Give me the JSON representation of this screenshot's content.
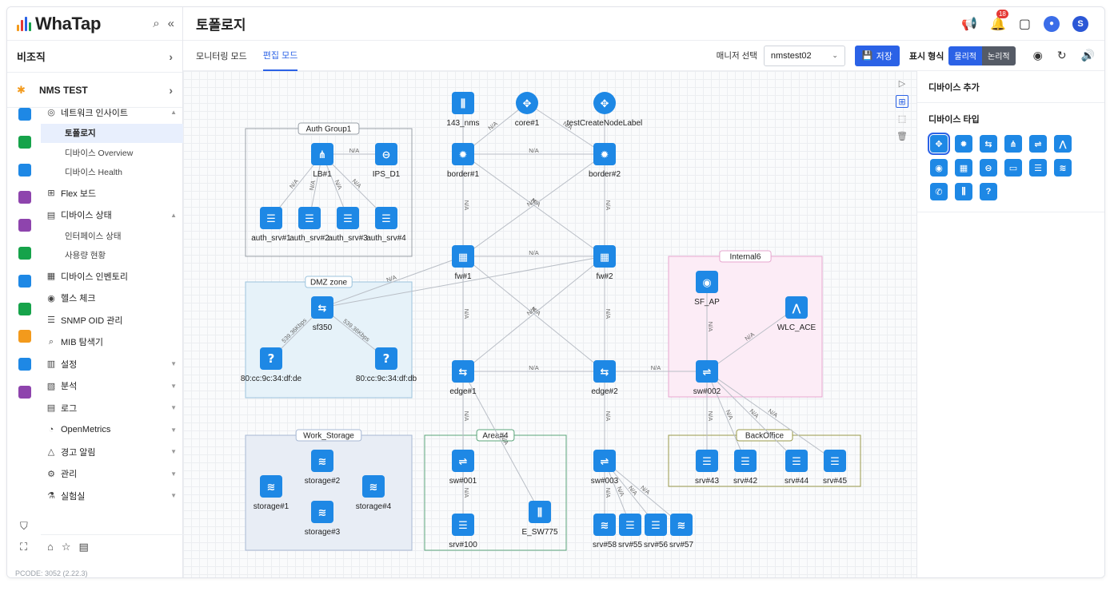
{
  "brand": {
    "name": "WhaTap",
    "bar_colors": [
      "#f39a1c",
      "#e53935",
      "#2b62e6",
      "#16a34a"
    ]
  },
  "sidebar": {
    "org_label": "비조직",
    "project_label": "NMS TEST",
    "rail_colors": [
      "#1e88e5",
      "#16a34a",
      "#1e88e5",
      "#8e44ad",
      "#8e44ad",
      "#16a34a",
      "#1e88e5",
      "#16a34a",
      "#f39a1c",
      "#1e88e5",
      "#8e44ad"
    ],
    "menu": [
      {
        "icon": "globe-icon",
        "glyph": "◎",
        "label": "네트워크 인사이트",
        "caret": "▲",
        "subs": [
          "토폴로지",
          "디바이스 Overview",
          "디바이스 Health"
        ]
      },
      {
        "icon": "board-icon",
        "glyph": "⊞",
        "label": "Flex 보드"
      },
      {
        "icon": "device-status-icon",
        "glyph": "▤",
        "label": "디바이스 상태",
        "caret": "▲",
        "subs": [
          "인터페이스 상태",
          "사용량 현황"
        ]
      },
      {
        "icon": "inventory-icon",
        "glyph": "▦",
        "label": "디바이스 인벤토리"
      },
      {
        "icon": "eye-icon",
        "glyph": "◉",
        "label": "헬스 체크"
      },
      {
        "icon": "list-icon",
        "glyph": "☰",
        "label": "SNMP OID 관리"
      },
      {
        "icon": "search-doc-icon",
        "glyph": "⌕",
        "label": "MIB 탐색기"
      },
      {
        "icon": "chart-icon",
        "glyph": "▥",
        "label": "설정",
        "caret": "▼"
      },
      {
        "icon": "analysis-icon",
        "glyph": "▧",
        "label": "분석",
        "caret": "▼"
      },
      {
        "icon": "log-icon",
        "glyph": "▤",
        "label": "로그",
        "caret": "▼"
      },
      {
        "icon": "gauge-icon",
        "glyph": "◔",
        "label": "OpenMetrics",
        "caret": "▼"
      },
      {
        "icon": "bell-icon",
        "glyph": "△",
        "label": "경고 알림",
        "caret": "▼"
      },
      {
        "icon": "gear-icon",
        "glyph": "⚙",
        "label": "관리",
        "caret": "▼"
      },
      {
        "icon": "flask-icon",
        "glyph": "⚗",
        "label": "실험실",
        "caret": "▼"
      }
    ],
    "pcode": "PCODE: 3052 (2.22.3)"
  },
  "header": {
    "title": "토폴로지",
    "notification_count": "18",
    "avatar_letter": "S"
  },
  "toolbar": {
    "tabs": [
      "모니터링 모드",
      "편집 모드"
    ],
    "manager_label": "매니저 선택",
    "manager_value": "nmstest02",
    "save_label": "저장",
    "display_label": "표시 형식",
    "display_options": [
      "물리적",
      "논리적"
    ]
  },
  "right_panel": {
    "add_title": "디바이스 추가",
    "type_title": "디바이스 타입",
    "types": [
      "router",
      "switch-l3",
      "switch",
      "loadbalancer",
      "switch-l2",
      "wlc",
      "ap",
      "firewall",
      "ips",
      "ids",
      "server",
      "storage",
      "phone",
      "e-switch",
      "unknown"
    ]
  },
  "topology": {
    "groups": [
      {
        "id": "g1",
        "label": "Auth Group1",
        "color": "#9aa0a8",
        "fill": "none"
      },
      {
        "id": "g2",
        "label": "DMZ zone",
        "color": "#9cc3dd",
        "fill": "#e6f2f9"
      },
      {
        "id": "g3",
        "label": "Internal6",
        "color": "#e7a6cf",
        "fill": "#fcecf6"
      },
      {
        "id": "g4",
        "label": "Work_Storage",
        "color": "#a7b8d4",
        "fill": "#e8edf5"
      },
      {
        "id": "g5",
        "label": "Area#4",
        "color": "#5aa47a",
        "fill": "none"
      },
      {
        "id": "g6",
        "label": "BackOffice",
        "color": "#9a9a4a",
        "fill": "none"
      }
    ],
    "nodes": [
      {
        "id": "n143",
        "label": "143_nms",
        "type": "e-switch"
      },
      {
        "id": "core1",
        "label": "core#1",
        "type": "router"
      },
      {
        "id": "tcnl",
        "label": "testCreateNodeLabel",
        "type": "router"
      },
      {
        "id": "border1",
        "label": "border#1",
        "type": "switch-l3"
      },
      {
        "id": "border2",
        "label": "border#2",
        "type": "switch-l3"
      },
      {
        "id": "lb1",
        "label": "LB#1",
        "type": "loadbalancer"
      },
      {
        "id": "ips",
        "label": "IPS_D1",
        "type": "ips"
      },
      {
        "id": "as1",
        "label": "auth_srv#1",
        "type": "server"
      },
      {
        "id": "as2",
        "label": "auth_srv#2",
        "type": "server"
      },
      {
        "id": "as3",
        "label": "auth_srv#3",
        "type": "server"
      },
      {
        "id": "as4",
        "label": "auth_srv#4",
        "type": "server"
      },
      {
        "id": "fw1",
        "label": "fw#1",
        "type": "firewall"
      },
      {
        "id": "fw2",
        "label": "fw#2",
        "type": "firewall"
      },
      {
        "id": "sf350",
        "label": "sf350",
        "type": "switch"
      },
      {
        "id": "u1",
        "label": "80:cc:9c:34:df:de",
        "type": "unknown"
      },
      {
        "id": "u2",
        "label": "80:cc:9c:34:df:db",
        "type": "unknown"
      },
      {
        "id": "sfap",
        "label": "SF_AP",
        "type": "ap"
      },
      {
        "id": "wlc",
        "label": "WLC_ACE",
        "type": "wlc"
      },
      {
        "id": "edge1",
        "label": "edge#1",
        "type": "switch"
      },
      {
        "id": "edge2",
        "label": "edge#2",
        "type": "switch"
      },
      {
        "id": "sw002",
        "label": "sw#002",
        "type": "switch-l2"
      },
      {
        "id": "st1",
        "label": "storage#1",
        "type": "storage"
      },
      {
        "id": "st2",
        "label": "storage#2",
        "type": "storage"
      },
      {
        "id": "st3",
        "label": "storage#3",
        "type": "storage"
      },
      {
        "id": "st4",
        "label": "storage#4",
        "type": "storage"
      },
      {
        "id": "sw001",
        "label": "sw#001",
        "type": "switch-l2"
      },
      {
        "id": "srv100",
        "label": "srv#100",
        "type": "server"
      },
      {
        "id": "esw",
        "label": "E_SW775",
        "type": "e-switch"
      },
      {
        "id": "sw003",
        "label": "sw#003",
        "type": "switch-l2"
      },
      {
        "id": "s58",
        "label": "srv#58",
        "type": "storage"
      },
      {
        "id": "s55",
        "label": "srv#55",
        "type": "server"
      },
      {
        "id": "s56",
        "label": "srv#56",
        "type": "server"
      },
      {
        "id": "s57",
        "label": "srv#57",
        "type": "storage"
      },
      {
        "id": "s43",
        "label": "srv#43",
        "type": "server"
      },
      {
        "id": "s42",
        "label": "srv#42",
        "type": "server"
      },
      {
        "id": "s44",
        "label": "srv#44",
        "type": "server"
      },
      {
        "id": "s45",
        "label": "srv#45",
        "type": "server"
      }
    ],
    "links": [
      {
        "a": "n143",
        "b": "border1",
        "label": ""
      },
      {
        "a": "core1",
        "b": "border1",
        "label": "N/A"
      },
      {
        "a": "core1",
        "b": "border2",
        "label": "N/A"
      },
      {
        "a": "tcnl",
        "b": "border2",
        "label": ""
      },
      {
        "a": "border1",
        "b": "border2",
        "label": "N/A"
      },
      {
        "a": "border1",
        "b": "fw1",
        "label": "N/A"
      },
      {
        "a": "border2",
        "b": "fw2",
        "label": "N/A"
      },
      {
        "a": "border1",
        "b": "fw2",
        "label": "N/A"
      },
      {
        "a": "border2",
        "b": "fw1",
        "label": "N/A"
      },
      {
        "a": "fw1",
        "b": "fw2",
        "label": "N/A"
      },
      {
        "a": "lb1",
        "b": "ips",
        "label": "N/A"
      },
      {
        "a": "lb1",
        "b": "as1",
        "label": "N/A"
      },
      {
        "a": "lb1",
        "b": "as2",
        "label": "N/A"
      },
      {
        "a": "lb1",
        "b": "as3",
        "label": "N/A"
      },
      {
        "a": "lb1",
        "b": "as4",
        "label": "N/A"
      },
      {
        "a": "sf350",
        "b": "fw1",
        "label": "N/A"
      },
      {
        "a": "sf350",
        "b": "fw2",
        "label": ""
      },
      {
        "a": "sf350",
        "b": "u1",
        "label": "539.36Kbps"
      },
      {
        "a": "sf350",
        "b": "u2",
        "label": "539.36Kbps"
      },
      {
        "a": "fw1",
        "b": "edge1",
        "label": "N/A"
      },
      {
        "a": "fw2",
        "b": "edge2",
        "label": "N/A"
      },
      {
        "a": "fw1",
        "b": "edge2",
        "label": "N/A"
      },
      {
        "a": "fw2",
        "b": "edge1",
        "label": "N/A"
      },
      {
        "a": "edge1",
        "b": "edge2",
        "label": "N/A"
      },
      {
        "a": "edge2",
        "b": "sw002",
        "label": "N/A"
      },
      {
        "a": "sfap",
        "b": "sw002",
        "label": "N/A"
      },
      {
        "a": "wlc",
        "b": "sw002",
        "label": "N/A"
      },
      {
        "a": "edge1",
        "b": "sw001",
        "label": "N/A"
      },
      {
        "a": "edge1",
        "b": "esw",
        "label": "N/A"
      },
      {
        "a": "sw001",
        "b": "srv100",
        "label": "N/A"
      },
      {
        "a": "edge2",
        "b": "sw003",
        "label": "N/A"
      },
      {
        "a": "sw003",
        "b": "s58",
        "label": "N/A"
      },
      {
        "a": "sw003",
        "b": "s55",
        "label": "N/A"
      },
      {
        "a": "sw003",
        "b": "s56",
        "label": "N/A"
      },
      {
        "a": "sw003",
        "b": "s57",
        "label": "N/A"
      },
      {
        "a": "sw002",
        "b": "s43",
        "label": "N/A"
      },
      {
        "a": "sw002",
        "b": "s42",
        "label": "N/A"
      },
      {
        "a": "sw002",
        "b": "s44",
        "label": "N/A"
      },
      {
        "a": "sw002",
        "b": "s45",
        "label": "N/A"
      }
    ]
  }
}
